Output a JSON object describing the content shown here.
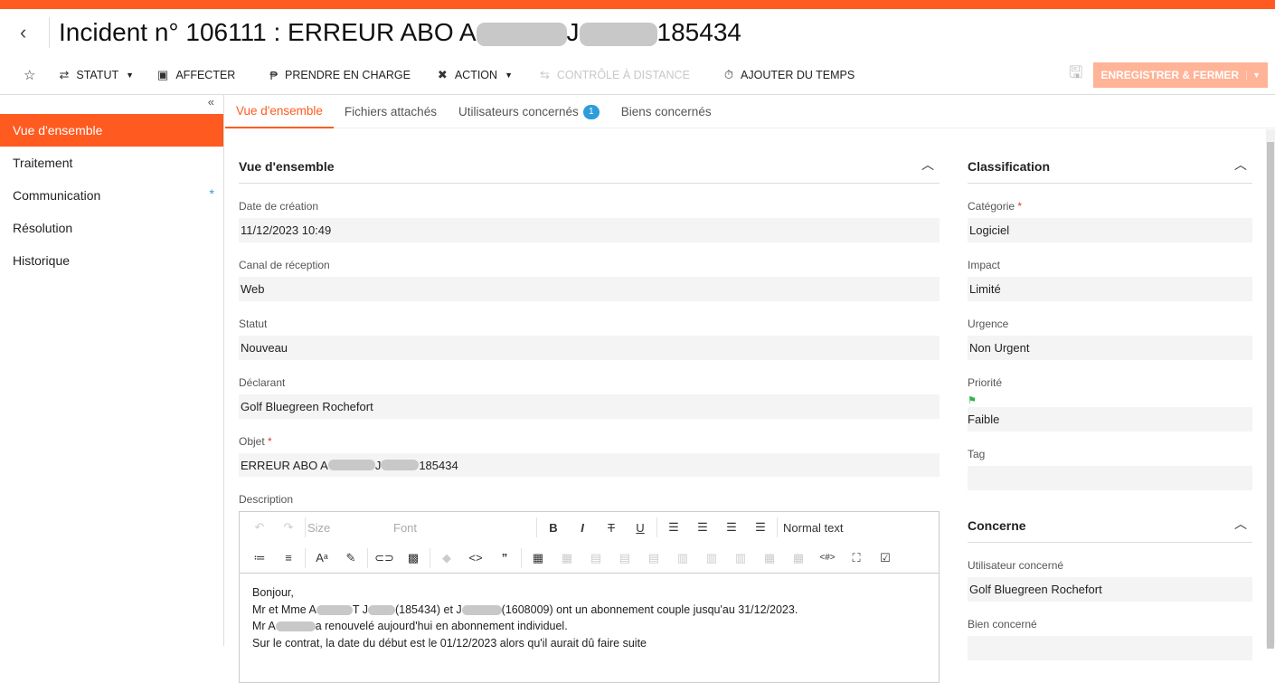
{
  "header": {
    "title_prefix": "Incident n° 106111 : ERREUR ABO A",
    "title_mid": "J",
    "title_suffix": "185434"
  },
  "toolbar": {
    "items": [
      {
        "label": "STATUT",
        "icon": "swap-icon",
        "dropdown": true
      },
      {
        "label": "AFFECTER",
        "icon": "assign-icon"
      },
      {
        "label": "PRENDRE EN CHARGE",
        "icon": "take-charge-icon"
      },
      {
        "label": "ACTION",
        "icon": "tools-icon",
        "dropdown": true
      },
      {
        "label": "CONTRÔLE À DISTANCE",
        "icon": "remote-icon",
        "disabled": true
      },
      {
        "label": "AJOUTER DU TEMPS",
        "icon": "timer-icon"
      }
    ],
    "save_label": "ENREGISTRER & FERMER"
  },
  "sidebar": {
    "items": [
      {
        "label": "Vue d'ensemble",
        "active": true
      },
      {
        "label": "Traitement"
      },
      {
        "label": "Communication",
        "marker": "*"
      },
      {
        "label": "Résolution"
      },
      {
        "label": "Historique"
      }
    ]
  },
  "tabs": [
    {
      "label": "Vue d'ensemble",
      "active": true
    },
    {
      "label": "Fichiers attachés"
    },
    {
      "label": "Utilisateurs concernés",
      "badge": "1"
    },
    {
      "label": "Biens concernés"
    }
  ],
  "overview": {
    "section_title": "Vue d'ensemble",
    "creation_label": "Date de création",
    "creation_value": "11/12/2023 10:49",
    "channel_label": "Canal de réception",
    "channel_value": "Web",
    "status_label": "Statut",
    "status_value": "Nouveau",
    "declarant_label": "Déclarant",
    "declarant_value": "Golf Bluegreen Rochefort",
    "object_label": "Objet",
    "object_value_a": "ERREUR ABO A",
    "object_value_b": "J",
    "object_value_c": "185434",
    "description_label": "Description"
  },
  "editor": {
    "size_label": "Size",
    "font_label": "Font",
    "format_label": "Normal text",
    "line1": "Bonjour,",
    "line2_a": "Mr et Mme A",
    "line2_b": "T J",
    "line2_c": "(185434) et J",
    "line2_d": "(1608009) ont un abonnement couple jusqu'au 31/12/2023.",
    "line3_a": "Mr A",
    "line3_b": "a renouvelé aujourd'hui en abonnement individuel.",
    "line4": "Sur le contrat, la date du début est le 01/12/2023 alors qu'il aurait dû faire suite"
  },
  "classification": {
    "section_title": "Classification",
    "category_label": "Catégorie",
    "category_value": "Logiciel",
    "impact_label": "Impact",
    "impact_value": "Limité",
    "urgency_label": "Urgence",
    "urgency_value": "Non Urgent",
    "priority_label": "Priorité",
    "priority_value": "Faible",
    "priority_color": "#2fb34a",
    "tag_label": "Tag",
    "tag_value": ""
  },
  "concerne": {
    "section_title": "Concerne",
    "user_label": "Utilisateur concerné",
    "user_value": "Golf Bluegreen Rochefort",
    "asset_label": "Bien concerné",
    "asset_value": ""
  },
  "colors": {
    "accent": "#ff5a1f",
    "badge": "#2d9cdb"
  }
}
